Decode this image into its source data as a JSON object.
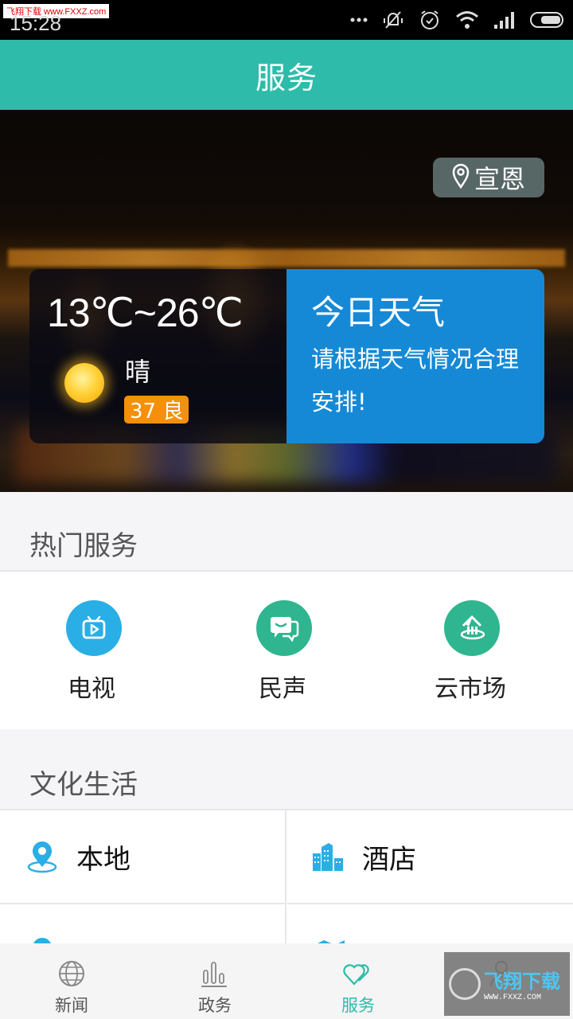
{
  "status_bar": {
    "time": "15:28",
    "watermark": "飞翔下载 www.FXXZ.com",
    "icons": [
      "more-dots-icon",
      "silent-bell-icon",
      "alarm-icon",
      "wifi-icon",
      "signal-icon",
      "battery-icon"
    ]
  },
  "header": {
    "title": "服务"
  },
  "banner": {
    "location": "宣恩",
    "weather": {
      "temp_range": "13℃~26℃",
      "condition": "晴",
      "aqi": "37 良",
      "title": "今日天气",
      "tip": "请根据天气情况合理安排!"
    }
  },
  "hot_services": {
    "title": "热门服务",
    "items": [
      {
        "label": "电视",
        "icon": "tv-icon",
        "color": "#2aaee6"
      },
      {
        "label": "民声",
        "icon": "chat-bubbles-icon",
        "color": "#2fb58f"
      },
      {
        "label": "云市场",
        "icon": "cloud-market-icon",
        "color": "#2fb58f"
      }
    ]
  },
  "culture_life": {
    "title": "文化生活",
    "items": [
      {
        "label": "本地",
        "icon": "location-pin-icon"
      },
      {
        "label": "酒店",
        "icon": "buildings-icon"
      },
      {
        "label": "",
        "icon": "location-pin-icon"
      },
      {
        "label": "",
        "icon": "map-icon"
      }
    ]
  },
  "bottom_nav": {
    "tabs": [
      {
        "label": "新闻",
        "icon": "globe-icon",
        "active": false
      },
      {
        "label": "政务",
        "icon": "bar-chart-icon",
        "active": false
      },
      {
        "label": "服务",
        "icon": "hearts-icon",
        "active": true
      },
      {
        "label": "",
        "icon": "person-icon",
        "active": false
      }
    ],
    "watermark_cn": "飞翔下载",
    "watermark_url": "WWW.FXXZ.COM"
  },
  "colors": {
    "accent": "#2ebbaa",
    "weather_blue": "#1589d6",
    "aqi_orange": "#f5900c",
    "icon_blue": "#2aaee6",
    "icon_green": "#2fb58f"
  }
}
